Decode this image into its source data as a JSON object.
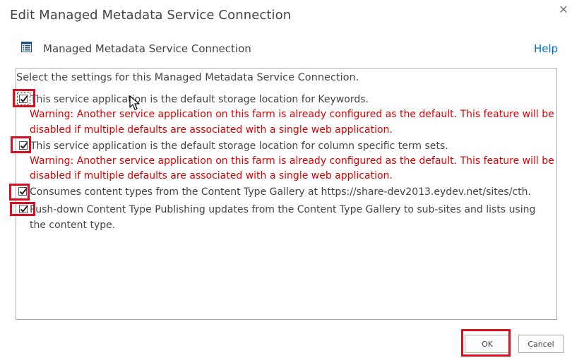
{
  "dialog": {
    "title": "Edit Managed Metadata Service Connection",
    "close_glyph": "✕"
  },
  "header": {
    "section_title": "Managed Metadata Service Connection",
    "help_label": "Help"
  },
  "settings": {
    "intro": "Select the settings for this Managed Metadata Service Connection.",
    "keywords_label": "This service application is the default storage location for Keywords.",
    "keywords_warning_line1": "Warning: Another service application on this farm is already configured as the default. This feature will be",
    "keywords_warning_line2": "disabled if multiple defaults are associated with a single web application.",
    "termsets_label": "This service application is the default storage location for column specific term sets.",
    "termsets_warning_line1": "Warning: Another service application on this farm is already configured as the default. This feature will be",
    "termsets_warning_line2": "disabled if multiple defaults are associated with a single web application.",
    "consumes_label": "Consumes content types from the Content Type Gallery at https://share-dev2013.eydev.net/sites/cth.",
    "pushdown_label_line1": "Push-down Content Type Publishing updates from the Content Type Gallery to sub-sites and lists using",
    "pushdown_label_line2": "the content type."
  },
  "buttons": {
    "ok_label": "OK",
    "cancel_label": "Cancel"
  },
  "colors": {
    "warning": "#e00000",
    "highlight": "#d90f1f",
    "link": "#0072c6"
  }
}
